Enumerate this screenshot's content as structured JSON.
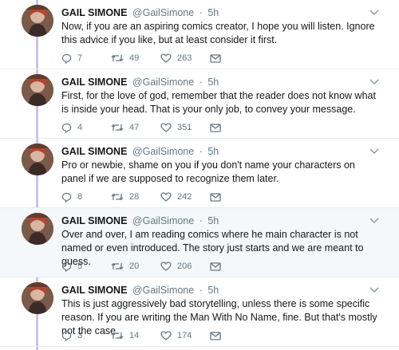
{
  "colors": {
    "text": "#14171a",
    "muted": "#657786",
    "thread_line": "#c9c4e8",
    "highlight_bg": "#f5f8fa"
  },
  "tweets": [
    {
      "name": "GAIL SIMONE",
      "handle": "@GailSimone",
      "sep": "·",
      "time": "5h",
      "text": "Now, if you are an aspiring comics creator, I hope you will listen. Ignore this advice if you like, but at least consider it first.",
      "replies": "7",
      "retweets": "49",
      "likes": "263",
      "highlighted": false
    },
    {
      "name": "GAIL SIMONE",
      "handle": "@GailSimone",
      "sep": "·",
      "time": "5h",
      "text": "First, for the love of god, remember that the reader does not know what is inside your head. That is your only job, to convey your message.",
      "replies": "4",
      "retweets": "47",
      "likes": "351",
      "highlighted": false
    },
    {
      "name": "GAIL SIMONE",
      "handle": "@GailSimone",
      "sep": "·",
      "time": "5h",
      "text": "Pro or newbie, shame on you if you don't name your characters on panel if we are supposed to recognize them later.",
      "replies": "8",
      "retweets": "28",
      "likes": "242",
      "highlighted": false
    },
    {
      "name": "GAIL SIMONE",
      "handle": "@GailSimone",
      "sep": "·",
      "time": "5h",
      "text": "Over and over, I am reading comics where he main character is not named or even introduced. The story just starts and we are meant to guess.",
      "replies": "5",
      "retweets": "20",
      "likes": "206",
      "highlighted": true
    },
    {
      "name": "GAIL SIMONE",
      "handle": "@GailSimone",
      "sep": "·",
      "time": "5h",
      "text": "This is just aggressively bad storytelling, unless there is some specific reason. If you are writing the Man With No Name, fine. But that's mostly not the case.",
      "replies": "3",
      "retweets": "14",
      "likes": "174",
      "highlighted": false
    }
  ]
}
